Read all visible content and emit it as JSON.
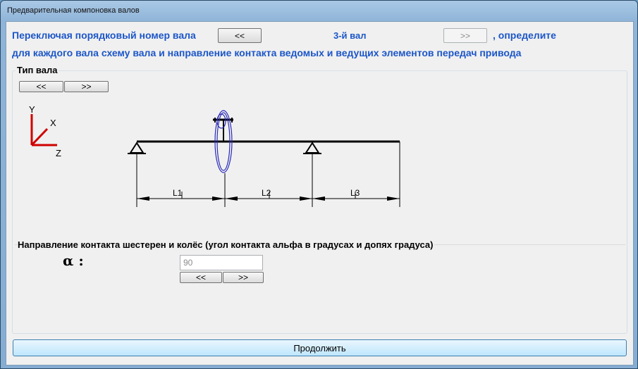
{
  "window": {
    "title": "Предварительная компоновка валов"
  },
  "header": {
    "prefix_text": "Переключая порядковый номер вала",
    "prev_label": "<<",
    "shaft_label": "3-й вал",
    "next_label": ">>",
    "suffix_text": ", определите",
    "line2_text": "для каждого вала схему вала и направление контакта ведомых и ведущих элементов передач привода"
  },
  "shaft_type": {
    "legend": "Тип вала",
    "prev_label": "<<",
    "next_label": ">>"
  },
  "diagram": {
    "axis_y": "Y",
    "axis_x": "X",
    "axis_z": "Z",
    "dim_l1": "L1",
    "dim_l2": "L2",
    "dim_l3": "L3"
  },
  "contact": {
    "legend": "Направление контакта шестерен и колёс (угол контакта альфа в градусах и допях градуса)",
    "alpha_label": "α :",
    "value": "90",
    "prev_label": "<<",
    "next_label": ">>"
  },
  "footer": {
    "continue_label": "Продолжить"
  }
}
